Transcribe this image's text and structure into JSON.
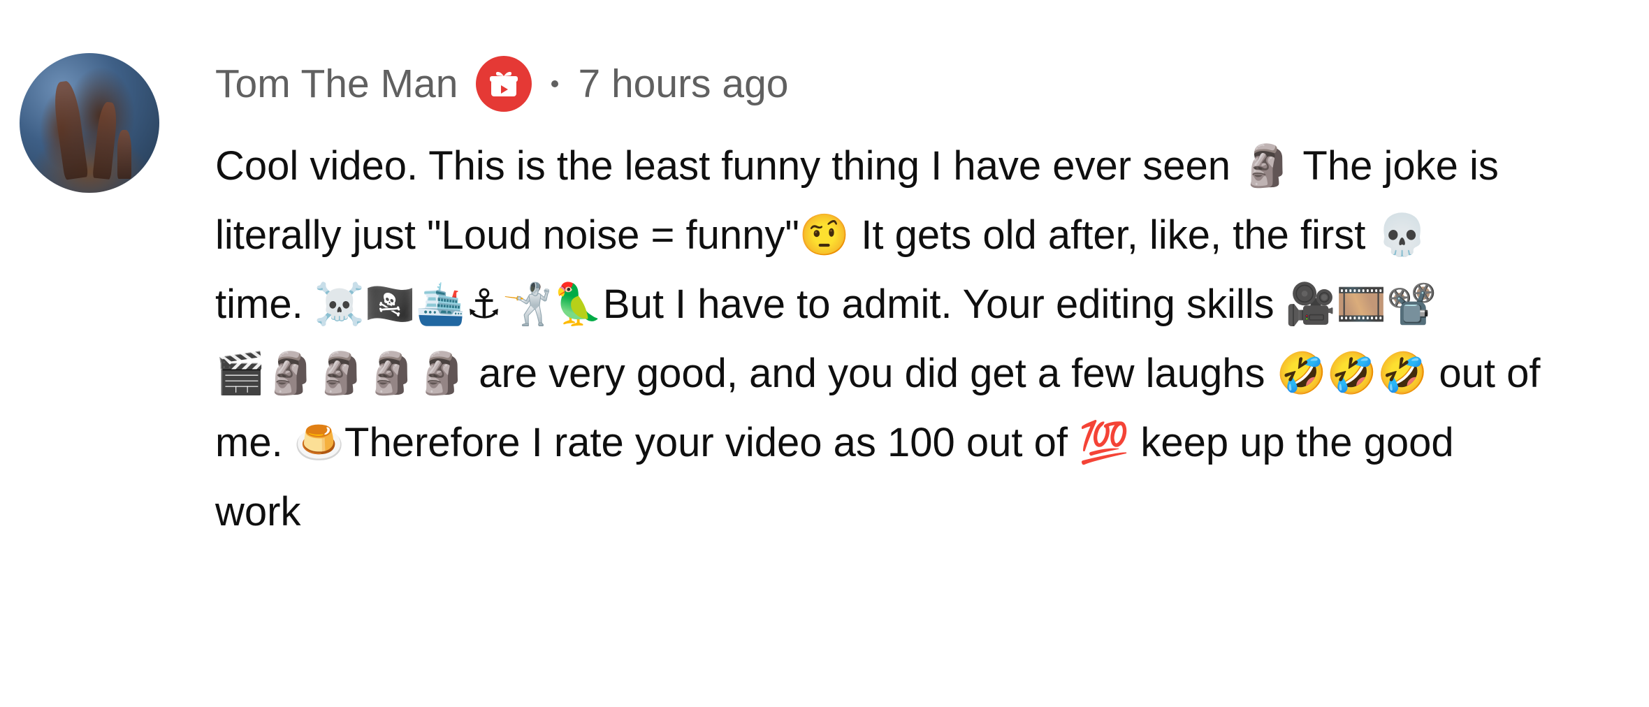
{
  "comment": {
    "author": "Tom The Man",
    "badge_icon": "gift-box-icon",
    "badge_color": "#e53935",
    "separator": "•",
    "timestamp": "7 hours ago",
    "lines": [
      "Cool video. This is the least funny thing I have ever seen 🗿 The joke is",
      "literally just \"Loud noise = funny\"🤨 It gets old after, like, the first 💀",
      "time. ☠️🏴‍☠️🛳️⚓🤺🦜But I have to admit. Your editing skills 🎥🎞️📽️",
      "🎬🗿🗿🗿🗿 are very good, and you did get a few laughs 🤣🤣🤣 out of",
      "me. 🍮Therefore I rate your video as 100 out of 💯 keep up the good",
      "work"
    ]
  }
}
